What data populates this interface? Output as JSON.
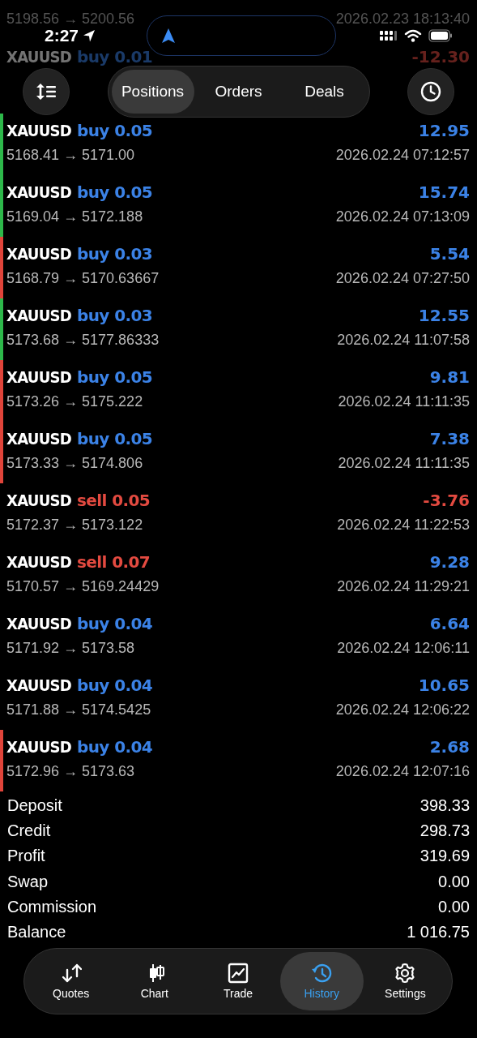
{
  "status_bar": {
    "time": "2:27"
  },
  "segments": [
    {
      "label": "Positions",
      "selected": true
    },
    {
      "label": "Orders",
      "selected": false
    },
    {
      "label": "Deals",
      "selected": false
    }
  ],
  "deals": [
    {
      "faded": true,
      "prices": "5198.56 → 5200.56",
      "time": "2026.02.23 18:13:40"
    },
    {
      "faded": true,
      "symbol": "XAUUSD",
      "trade": "buy 0.01",
      "kind": "buy",
      "profit": "-12.30",
      "loss": true
    },
    {
      "faded": false,
      "symbol": "XAUUSD",
      "trade": "buy 0.05",
      "kind": "buy",
      "profit": "12.95",
      "loss": false,
      "prices": "5168.41 → 5171.00",
      "time": "2026.02.24 07:12:57",
      "color": "#2db84a"
    },
    {
      "faded": false,
      "symbol": "XAUUSD",
      "trade": "buy 0.05",
      "kind": "buy",
      "profit": "15.74",
      "loss": false,
      "prices": "5169.04 → 5172.188",
      "time": "2026.02.24 07:13:09",
      "color": "#2db84a"
    },
    {
      "faded": false,
      "symbol": "XAUUSD",
      "trade": "buy 0.03",
      "kind": "buy",
      "profit": "5.54",
      "loss": false,
      "prices": "5168.79 → 5170.63667",
      "time": "2026.02.24 07:27:50",
      "color": "#e0443a"
    },
    {
      "faded": false,
      "symbol": "XAUUSD",
      "trade": "buy 0.03",
      "kind": "buy",
      "profit": "12.55",
      "loss": false,
      "prices": "5173.68 → 5177.86333",
      "time": "2026.02.24 11:07:58",
      "color": "#2db84a"
    },
    {
      "faded": false,
      "symbol": "XAUUSD",
      "trade": "buy 0.05",
      "kind": "buy",
      "profit": "9.81",
      "loss": false,
      "prices": "5173.26 → 5175.222",
      "time": "2026.02.24 11:11:35",
      "color": "#e0443a"
    },
    {
      "faded": false,
      "symbol": "XAUUSD",
      "trade": "buy 0.05",
      "kind": "buy",
      "profit": "7.38",
      "loss": false,
      "prices": "5173.33 → 5174.806",
      "time": "2026.02.24 11:11:35",
      "color": "#e0443a"
    },
    {
      "faded": false,
      "symbol": "XAUUSD",
      "trade": "sell 0.05",
      "kind": "sell",
      "profit": "-3.76",
      "loss": true,
      "prices": "5172.37 → 5173.122",
      "time": "2026.02.24 11:22:53"
    },
    {
      "faded": false,
      "symbol": "XAUUSD",
      "trade": "sell 0.07",
      "kind": "sell",
      "profit": "9.28",
      "loss": false,
      "prices": "5170.57 → 5169.24429",
      "time": "2026.02.24 11:29:21"
    },
    {
      "faded": false,
      "symbol": "XAUUSD",
      "trade": "buy 0.04",
      "kind": "buy",
      "profit": "6.64",
      "loss": false,
      "prices": "5171.92 → 5173.58",
      "time": "2026.02.24 12:06:11"
    },
    {
      "faded": false,
      "symbol": "XAUUSD",
      "trade": "buy 0.04",
      "kind": "buy",
      "profit": "10.65",
      "loss": false,
      "prices": "5171.88 → 5174.5425",
      "time": "2026.02.24 12:06:22"
    },
    {
      "faded": false,
      "symbol": "XAUUSD",
      "trade": "buy 0.04",
      "kind": "buy",
      "profit": "2.68",
      "loss": false,
      "prices": "5172.96 → 5173.63",
      "time": "2026.02.24 12:07:16",
      "color": "#e0443a"
    }
  ],
  "summary": [
    {
      "label": "Deposit",
      "value": "398.33"
    },
    {
      "label": "Credit",
      "value": "298.73"
    },
    {
      "label": "Profit",
      "value": "319.69"
    },
    {
      "label": "Swap",
      "value": "0.00"
    },
    {
      "label": "Commission",
      "value": "0.00"
    },
    {
      "label": "Balance",
      "value": "1 016.75"
    }
  ],
  "tab_bar": [
    {
      "label": "Quotes",
      "selected": false
    },
    {
      "label": "Chart",
      "selected": false
    },
    {
      "label": "Trade",
      "selected": false
    },
    {
      "label": "History",
      "selected": true
    },
    {
      "label": "Settings",
      "selected": false
    }
  ]
}
